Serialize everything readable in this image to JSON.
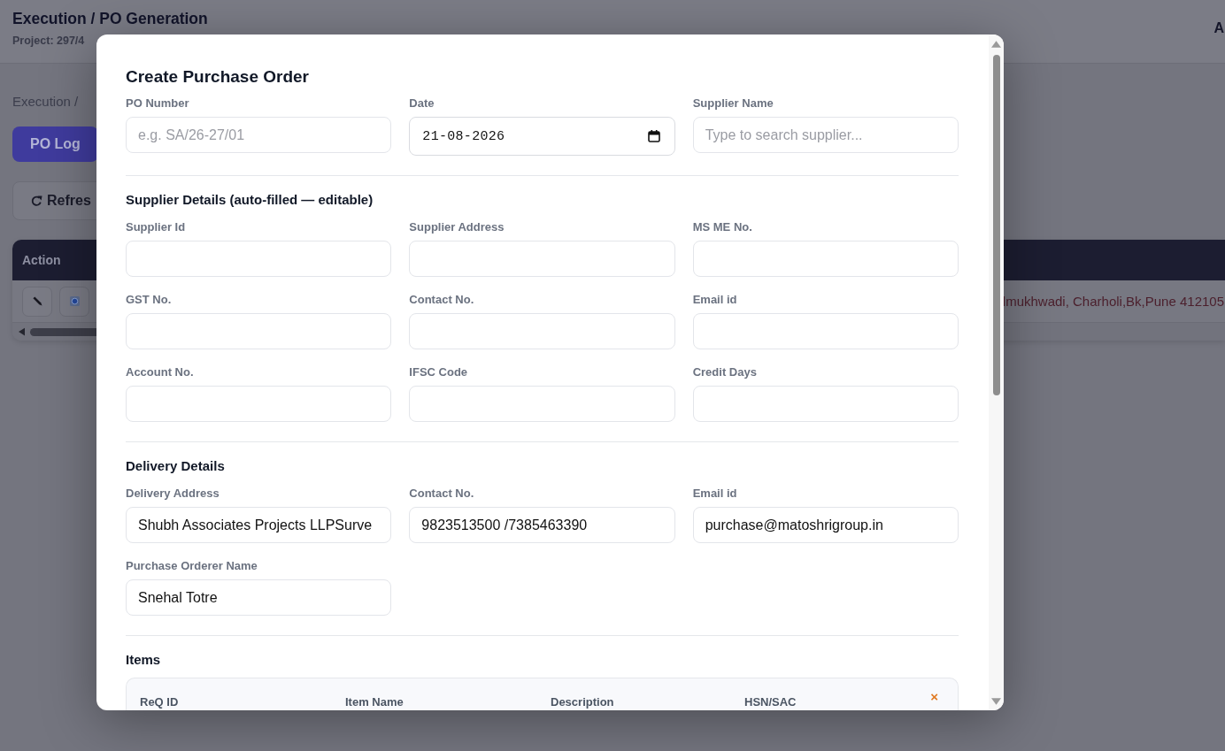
{
  "page": {
    "header": {
      "title": "Execution / PO Generation",
      "project": "Project: 297/4",
      "user": "A"
    },
    "breadcrumb": "Execution /",
    "buttons": [
      {
        "kind": "primary",
        "label": "PO Log"
      },
      {
        "kind": "refresh",
        "label": "Refres"
      }
    ],
    "table": {
      "columns": [
        "Action"
      ],
      "rows": [
        {
          "column_2": "lmukhwadi, Charholi,Bk,Pune 412105"
        }
      ]
    }
  },
  "modal": {
    "title": "Create Purchase Order",
    "sections": [
      {
        "fields": [
          {
            "label": "PO Number",
            "kind": "text",
            "placeholder": "e.g. SA/26-27/01"
          },
          {
            "label": "Date",
            "kind": "date",
            "value": "21-08-2026"
          },
          {
            "label": "Supplier Name",
            "kind": "text",
            "placeholder": "Type to search supplier..."
          }
        ]
      },
      {
        "title": "Supplier Details (auto-filled — editable)",
        "fields": [
          {
            "label": "Supplier Id",
            "kind": "text"
          },
          {
            "label": "Supplier Address",
            "kind": "text"
          },
          {
            "label": "MS ME No.",
            "kind": "text"
          },
          {
            "label": "GST No.",
            "kind": "text"
          },
          {
            "label": "Contact No.",
            "kind": "text"
          },
          {
            "label": "Email id",
            "kind": "text"
          },
          {
            "label": "Account No.",
            "kind": "text"
          },
          {
            "label": "IFSC Code",
            "kind": "text"
          },
          {
            "label": "Credit Days",
            "kind": "text"
          }
        ]
      },
      {
        "title": "Delivery Details",
        "fields": [
          {
            "label": "Delivery Address",
            "kind": "text",
            "value": "Shubh Associates Projects LLPSurve"
          },
          {
            "label": "Contact No.",
            "kind": "text",
            "value": "9823513500 /7385463390"
          },
          {
            "label": "Email id",
            "kind": "text",
            "value": "purchase@matoshrigroup.in"
          },
          {
            "label": "Purchase Orderer Name",
            "kind": "text",
            "value": "Snehal Totre"
          }
        ]
      }
    ],
    "items": {
      "title": "Items",
      "columns": [
        "ReQ ID",
        "Item Name",
        "Description",
        "HSN/SAC"
      ],
      "remove": "×"
    }
  }
}
